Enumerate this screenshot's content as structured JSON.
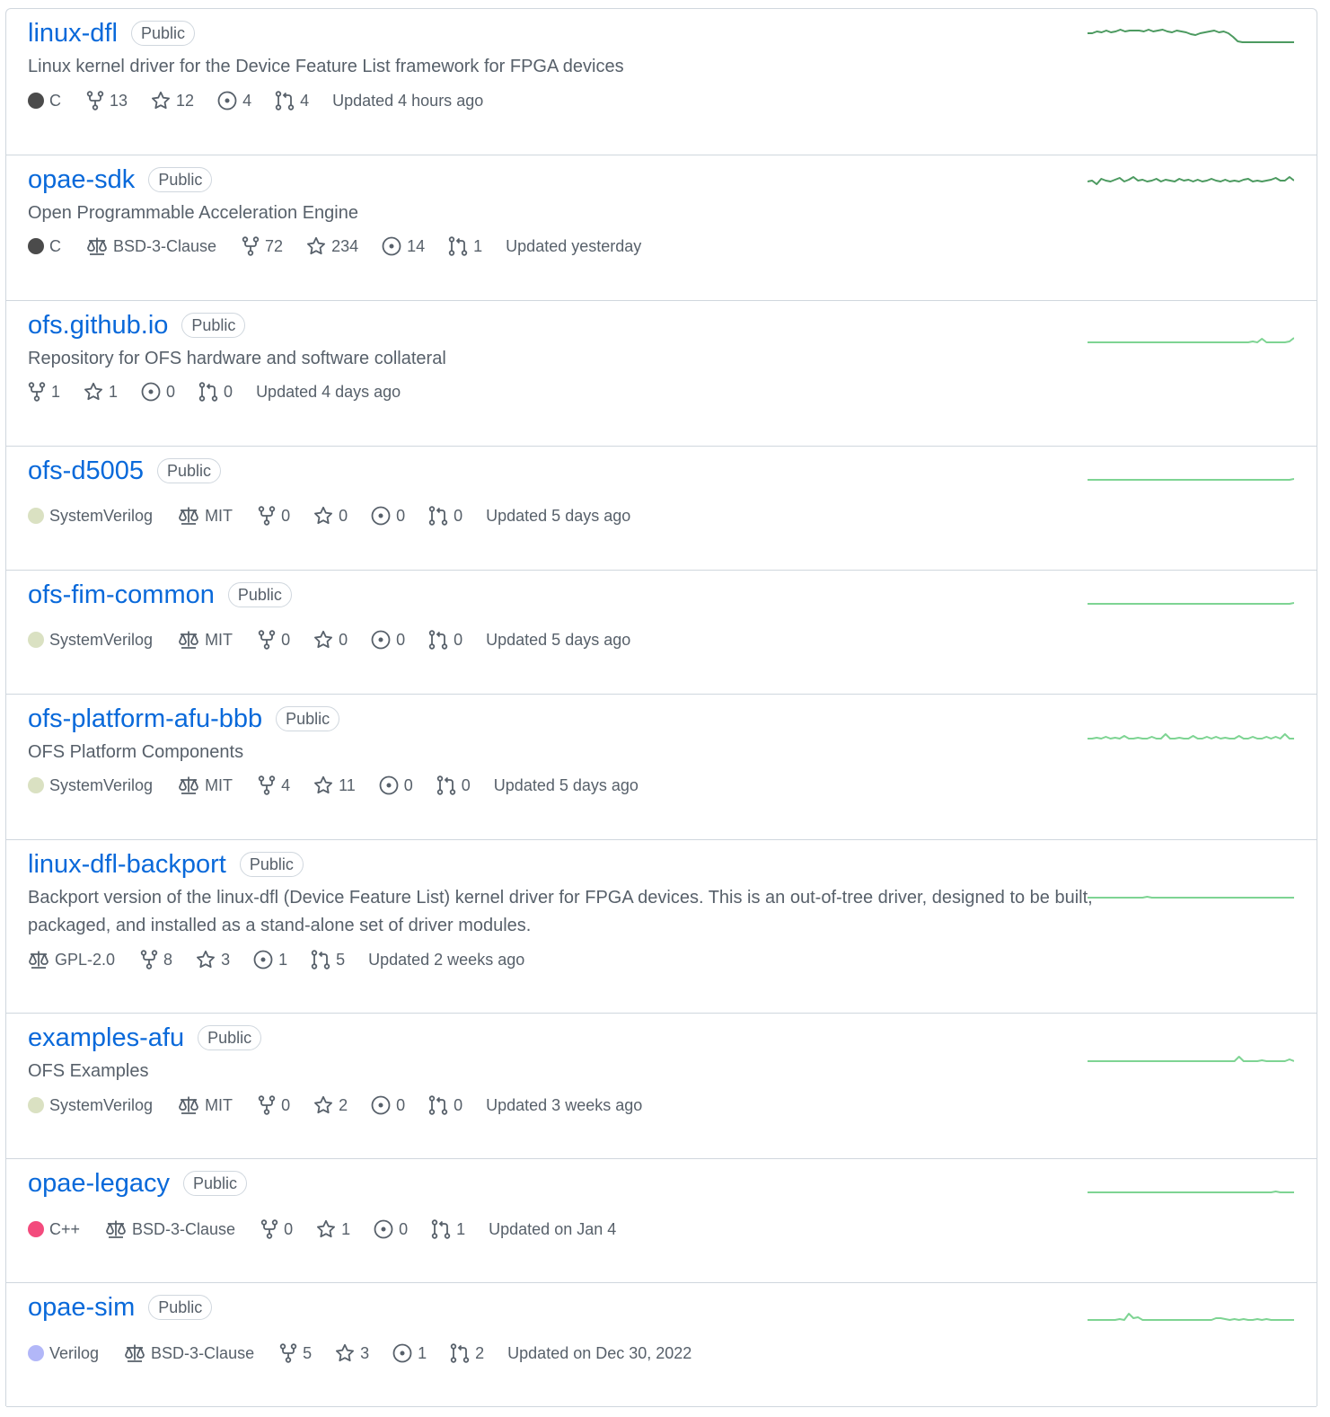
{
  "colors": {
    "link": "#0969da",
    "muted": "#57606a",
    "border": "#d0d7de",
    "spark_dark": "#4c9a60",
    "spark_light": "#7ed493"
  },
  "repos": [
    {
      "name": "linux-dfl",
      "visibility": "Public",
      "description": "Linux kernel driver for the Device Feature List framework for FPGA devices",
      "language": "C",
      "language_color": "#4b4b4b",
      "license": "",
      "forks": "13",
      "stars": "12",
      "issues": "4",
      "pulls": "4",
      "updated": "Updated 4 hours ago",
      "activity": [
        6,
        6,
        4,
        5,
        3,
        5,
        4,
        2,
        4,
        3,
        3,
        3,
        4,
        2,
        4,
        3,
        2,
        4,
        5,
        3,
        4,
        5,
        7,
        8,
        6,
        5,
        4,
        3,
        5,
        4,
        6,
        10,
        15,
        16,
        16,
        16,
        16,
        16,
        16,
        16,
        16,
        16,
        16,
        16,
        16
      ],
      "activity_tone": "dark"
    },
    {
      "name": "opae-sdk",
      "visibility": "Public",
      "description": "Open Programmable Acceleration Engine",
      "language": "C",
      "language_color": "#4b4b4b",
      "license": "BSD-3-Clause",
      "forks": "72",
      "stars": "234",
      "issues": "14",
      "pulls": "1",
      "updated": "Updated yesterday",
      "activity": [
        9,
        8,
        12,
        6,
        8,
        9,
        7,
        5,
        9,
        7,
        4,
        8,
        7,
        9,
        8,
        6,
        9,
        7,
        8,
        9,
        6,
        8,
        7,
        9,
        7,
        9,
        8,
        6,
        8,
        9,
        7,
        9,
        8,
        9,
        7,
        6,
        9,
        8,
        9,
        8,
        7,
        5,
        8,
        8,
        4,
        8
      ],
      "activity_tone": "dark"
    },
    {
      "name": "ofs.github.io",
      "visibility": "Public",
      "description": "Repository for OFS hardware and software collateral",
      "language": "",
      "language_color": "",
      "license": "",
      "forks": "1",
      "stars": "1",
      "issues": "0",
      "pulls": "0",
      "updated": "Updated 4 days ago",
      "activity": [
        16,
        16,
        16,
        16,
        16,
        16,
        16,
        16,
        16,
        16,
        16,
        16,
        16,
        16,
        16,
        16,
        16,
        16,
        16,
        16,
        16,
        16,
        16,
        16,
        16,
        16,
        16,
        16,
        16,
        16,
        16,
        16,
        16,
        16,
        16,
        16,
        15,
        16,
        12,
        16,
        16,
        16,
        16,
        16,
        15,
        11
      ],
      "activity_tone": "light"
    },
    {
      "name": "ofs-d5005",
      "visibility": "Public",
      "description": "",
      "language": "SystemVerilog",
      "language_color": "#dae1c2",
      "license": "MIT",
      "forks": "0",
      "stars": "0",
      "issues": "0",
      "pulls": "0",
      "updated": "Updated 5 days ago",
      "activity": [
        16,
        16,
        16,
        16,
        16,
        16,
        16,
        16,
        16,
        16,
        16,
        16,
        16,
        16,
        16,
        16,
        16,
        16,
        16,
        16,
        16,
        16,
        16,
        16,
        16,
        16,
        16,
        16,
        16,
        16,
        16,
        16,
        16,
        16,
        16,
        16,
        16,
        16,
        16,
        16,
        16,
        16,
        16,
        16,
        16,
        15
      ],
      "activity_tone": "light"
    },
    {
      "name": "ofs-fim-common",
      "visibility": "Public",
      "description": "",
      "language": "SystemVerilog",
      "language_color": "#dae1c2",
      "license": "MIT",
      "forks": "0",
      "stars": "0",
      "issues": "0",
      "pulls": "0",
      "updated": "Updated 5 days ago",
      "activity": [
        16,
        16,
        16,
        16,
        16,
        16,
        16,
        16,
        16,
        16,
        16,
        16,
        16,
        16,
        16,
        16,
        16,
        16,
        16,
        16,
        16,
        16,
        16,
        16,
        16,
        16,
        16,
        16,
        16,
        16,
        16,
        16,
        16,
        16,
        16,
        16,
        16,
        16,
        16,
        16,
        16,
        16,
        16,
        16,
        16,
        15
      ],
      "activity_tone": "light"
    },
    {
      "name": "ofs-platform-afu-bbb",
      "visibility": "Public",
      "description": "OFS Platform Components",
      "language": "SystemVerilog",
      "language_color": "#dae1c2",
      "license": "MIT",
      "forks": "4",
      "stars": "11",
      "issues": "0",
      "pulls": "0",
      "updated": "Updated 5 days ago",
      "activity": [
        14,
        14,
        13,
        14,
        12,
        14,
        13,
        14,
        11,
        14,
        14,
        13,
        14,
        14,
        12,
        14,
        14,
        9,
        14,
        14,
        13,
        14,
        14,
        11,
        14,
        14,
        12,
        14,
        12,
        14,
        13,
        14,
        14,
        11,
        14,
        14,
        12,
        14,
        14,
        12,
        14,
        12,
        14,
        9,
        14,
        14
      ],
      "activity_tone": "light"
    },
    {
      "name": "linux-dfl-backport",
      "visibility": "Public",
      "description": "Backport version of the linux-dfl (Device Feature List) kernel driver for FPGA devices. This is an out-of-tree driver, designed to be built, packaged, and installed as a stand-alone set of driver modules.",
      "language": "",
      "language_color": "",
      "license": "GPL-2.0",
      "forks": "8",
      "stars": "3",
      "issues": "1",
      "pulls": "5",
      "updated": "Updated 2 weeks ago",
      "activity": [
        16,
        16,
        16,
        16,
        16,
        16,
        16,
        16,
        16,
        16,
        16,
        16,
        16,
        15,
        16,
        16,
        16,
        16,
        16,
        16,
        16,
        16,
        16,
        16,
        16,
        16,
        16,
        16,
        16,
        16,
        16,
        16,
        16,
        16,
        16,
        16,
        16,
        16,
        16,
        16,
        16,
        16,
        16,
        16,
        16,
        16
      ],
      "activity_tone": "light"
    },
    {
      "name": "examples-afu",
      "visibility": "Public",
      "description": "OFS Examples",
      "language": "SystemVerilog",
      "language_color": "#dae1c2",
      "license": "MIT",
      "forks": "0",
      "stars": "2",
      "issues": "0",
      "pulls": "0",
      "updated": "Updated 3 weeks ago",
      "activity": [
        16,
        16,
        16,
        16,
        16,
        16,
        16,
        16,
        16,
        16,
        16,
        16,
        16,
        16,
        16,
        16,
        16,
        16,
        16,
        16,
        16,
        16,
        16,
        16,
        16,
        16,
        16,
        16,
        16,
        16,
        16,
        16,
        16,
        11,
        16,
        16,
        16,
        16,
        15,
        16,
        16,
        16,
        16,
        16,
        14,
        16
      ],
      "activity_tone": "light"
    },
    {
      "name": "opae-legacy",
      "visibility": "Public",
      "description": "",
      "language": "C++",
      "language_color": "#f34b7d",
      "license": "BSD-3-Clause",
      "forks": "0",
      "stars": "1",
      "issues": "0",
      "pulls": "1",
      "updated": "Updated on Jan 4",
      "activity": [
        16,
        16,
        16,
        16,
        16,
        16,
        16,
        16,
        16,
        16,
        16,
        16,
        16,
        16,
        16,
        16,
        16,
        16,
        16,
        16,
        16,
        16,
        16,
        16,
        16,
        16,
        16,
        16,
        16,
        16,
        16,
        16,
        16,
        16,
        16,
        16,
        16,
        16,
        16,
        16,
        16,
        15,
        16,
        16,
        16,
        16
      ],
      "activity_tone": "light"
    },
    {
      "name": "opae-sim",
      "visibility": "Public",
      "description": "",
      "language": "Verilog",
      "language_color": "#b2b7f8",
      "license": "BSD-3-Clause",
      "forks": "5",
      "stars": "3",
      "issues": "1",
      "pulls": "2",
      "updated": "Updated on Dec 30, 2022",
      "activity": [
        16,
        16,
        16,
        16,
        16,
        16,
        16,
        15,
        16,
        9,
        14,
        13,
        16,
        16,
        16,
        16,
        16,
        16,
        16,
        16,
        16,
        16,
        16,
        16,
        16,
        16,
        16,
        16,
        14,
        14,
        15,
        16,
        15,
        16,
        15,
        16,
        16,
        15,
        16,
        15,
        16,
        16,
        16,
        16,
        16,
        16
      ],
      "activity_tone": "light"
    }
  ]
}
